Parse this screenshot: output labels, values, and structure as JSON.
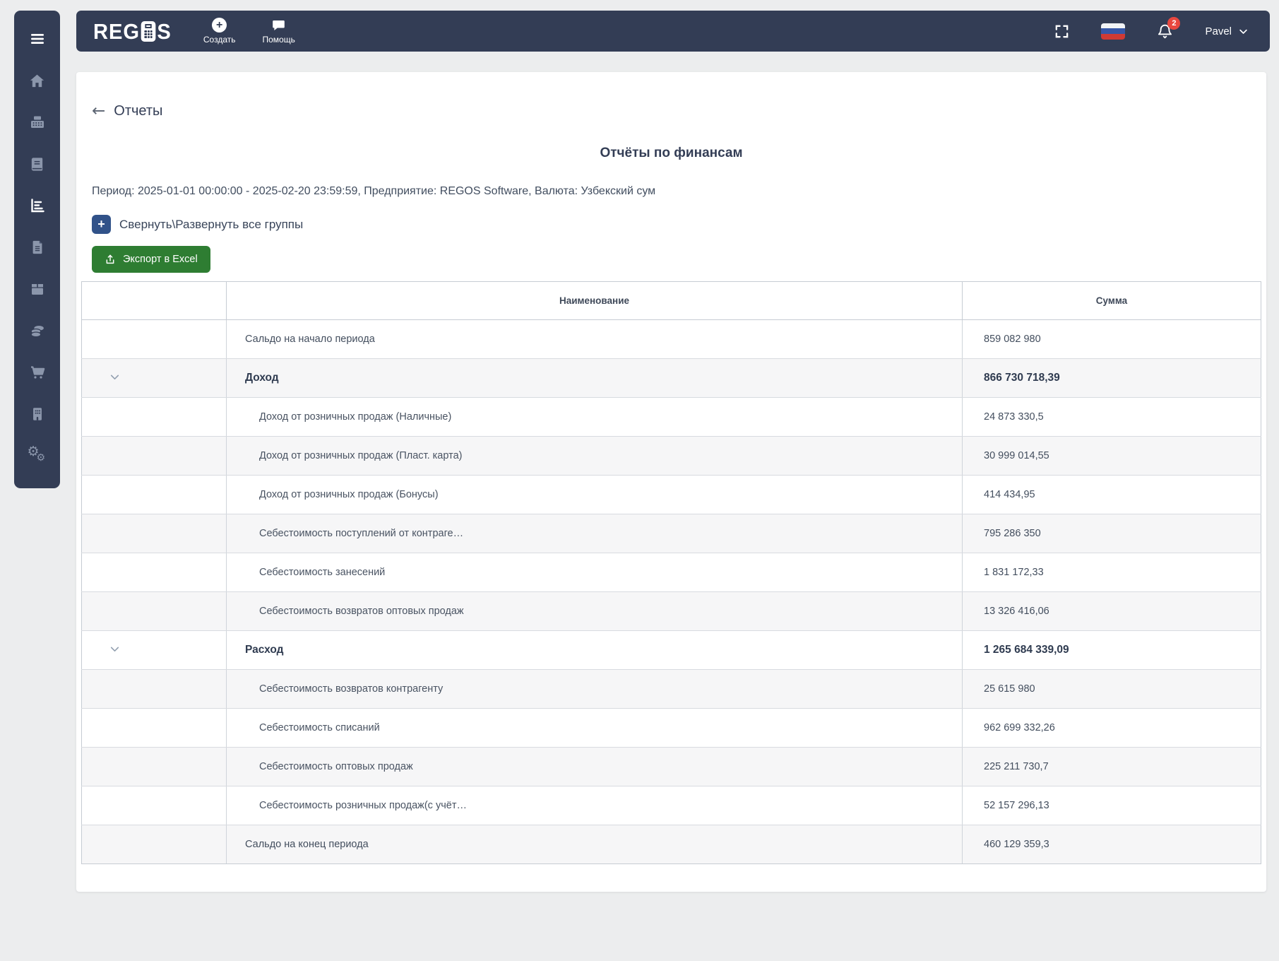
{
  "colors": {
    "navbar_sidebar": "#333d55",
    "accent_button_blue": "#315289",
    "export_green": "#2e7d32",
    "notification_red": "#e8473f",
    "page_background": "#ecedee",
    "zebra_row": "#f6f6f7"
  },
  "topbar": {
    "logo_prefix": "REG",
    "logo_suffix": "S",
    "create_label": "Создать",
    "help_label": "Помощь",
    "user_name": "Pavel",
    "notification_count": "2",
    "icons": [
      "plus-circle-icon",
      "chat-bubble-icon",
      "fullscreen-icon",
      "russian-flag-icon",
      "bell-icon",
      "chevron-down-icon"
    ]
  },
  "sidebar": {
    "icons": [
      "menu-icon",
      "home-icon",
      "cash-register-icon",
      "book-icon",
      "bar-chart-icon",
      "document-icon",
      "box-icon",
      "coins-icon",
      "cart-icon",
      "building-icon",
      "gears-icon"
    ],
    "active_icon": "bar-chart-icon"
  },
  "page": {
    "back_title": "Отчеты",
    "report_title": "Отчёты по финансам",
    "meta": "Период: 2025-01-01 00:00:00 - 2025-02-20 23:59:59, Предприятие: REGOS Software, Валюта: Узбекский сум",
    "collapse_label": "Свернуть\\Развернуть все группы",
    "export_label": "Экспорт в Excel"
  },
  "table": {
    "name_header": "Наименование",
    "amount_header": "Сумма",
    "rows": [
      {
        "name": "Сальдо на начало периода",
        "amount": "859 082 980",
        "type": "top",
        "chevron": false
      },
      {
        "name": "Доход",
        "amount": "866 730 718,39",
        "type": "group",
        "chevron": true
      },
      {
        "name": "Доход от розничных продаж (Наличные)",
        "amount": "24 873 330,5",
        "type": "sub",
        "chevron": false
      },
      {
        "name": "Доход от розничных продаж (Пласт. карта)",
        "amount": "30 999 014,55",
        "type": "sub",
        "chevron": false
      },
      {
        "name": "Доход от розничных продаж (Бонусы)",
        "amount": "414 434,95",
        "type": "sub",
        "chevron": false
      },
      {
        "name": "Себестоимость поступлений от контраге…",
        "amount": "795 286 350",
        "type": "sub",
        "chevron": false
      },
      {
        "name": "Себестоимость занесений",
        "amount": "1 831 172,33",
        "type": "sub",
        "chevron": false
      },
      {
        "name": "Себестоимость возвратов оптовых продаж",
        "amount": "13 326 416,06",
        "type": "sub",
        "chevron": false
      },
      {
        "name": "Расход",
        "amount": "1 265 684 339,09",
        "type": "group",
        "chevron": true
      },
      {
        "name": "Себестоимость возвратов контрагенту",
        "amount": "25 615 980",
        "type": "sub",
        "chevron": false
      },
      {
        "name": "Себестоимость списаний",
        "amount": "962 699 332,26",
        "type": "sub",
        "chevron": false
      },
      {
        "name": "Себестоимость оптовых продаж",
        "amount": "225 211 730,7",
        "type": "sub",
        "chevron": false
      },
      {
        "name": "Себестоимость розничных продаж(с учёт…",
        "amount": "52 157 296,13",
        "type": "sub",
        "chevron": false
      },
      {
        "name": "Сальдо на конец периода",
        "amount": "460 129 359,3",
        "type": "top",
        "chevron": false
      }
    ]
  }
}
